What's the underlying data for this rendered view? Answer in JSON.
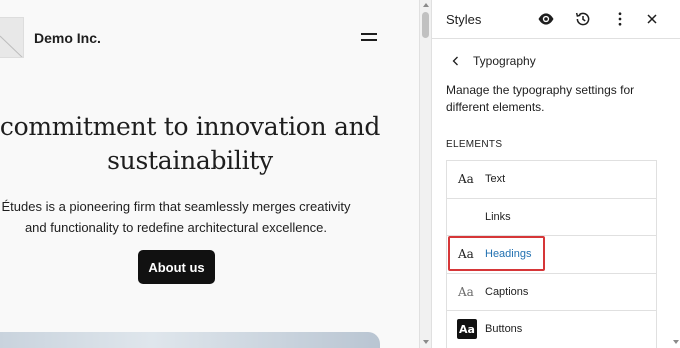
{
  "preview": {
    "site_title": "Demo Inc.",
    "hero_heading": "commitment to innovation and sustainability",
    "hero_text": "Études is a pioneering firm that seamlessly merges creativity and functionality to redefine architectural excellence.",
    "cta_label": "About us"
  },
  "sidebar": {
    "title": "Styles",
    "subtitle": "Typography",
    "description": "Manage the typography settings for different elements.",
    "section_label": "ELEMENTS",
    "elements": [
      {
        "aa": "Aa",
        "label": "Text"
      },
      {
        "aa": "",
        "label": "Links"
      },
      {
        "aa": "Aa",
        "label": "Headings"
      },
      {
        "aa": "Aa",
        "label": "Captions"
      },
      {
        "aa": "Aa",
        "label": "Buttons"
      }
    ],
    "icons": {
      "eye": "eye-icon",
      "history": "history-icon",
      "more": "more-vertical-icon",
      "close": "close-icon",
      "back": "chevron-left-icon",
      "menu": "hamburger-menu-icon"
    }
  },
  "colors": {
    "accent": "#2271b1",
    "highlight_border": "#d63638",
    "button_bg": "#111111"
  }
}
